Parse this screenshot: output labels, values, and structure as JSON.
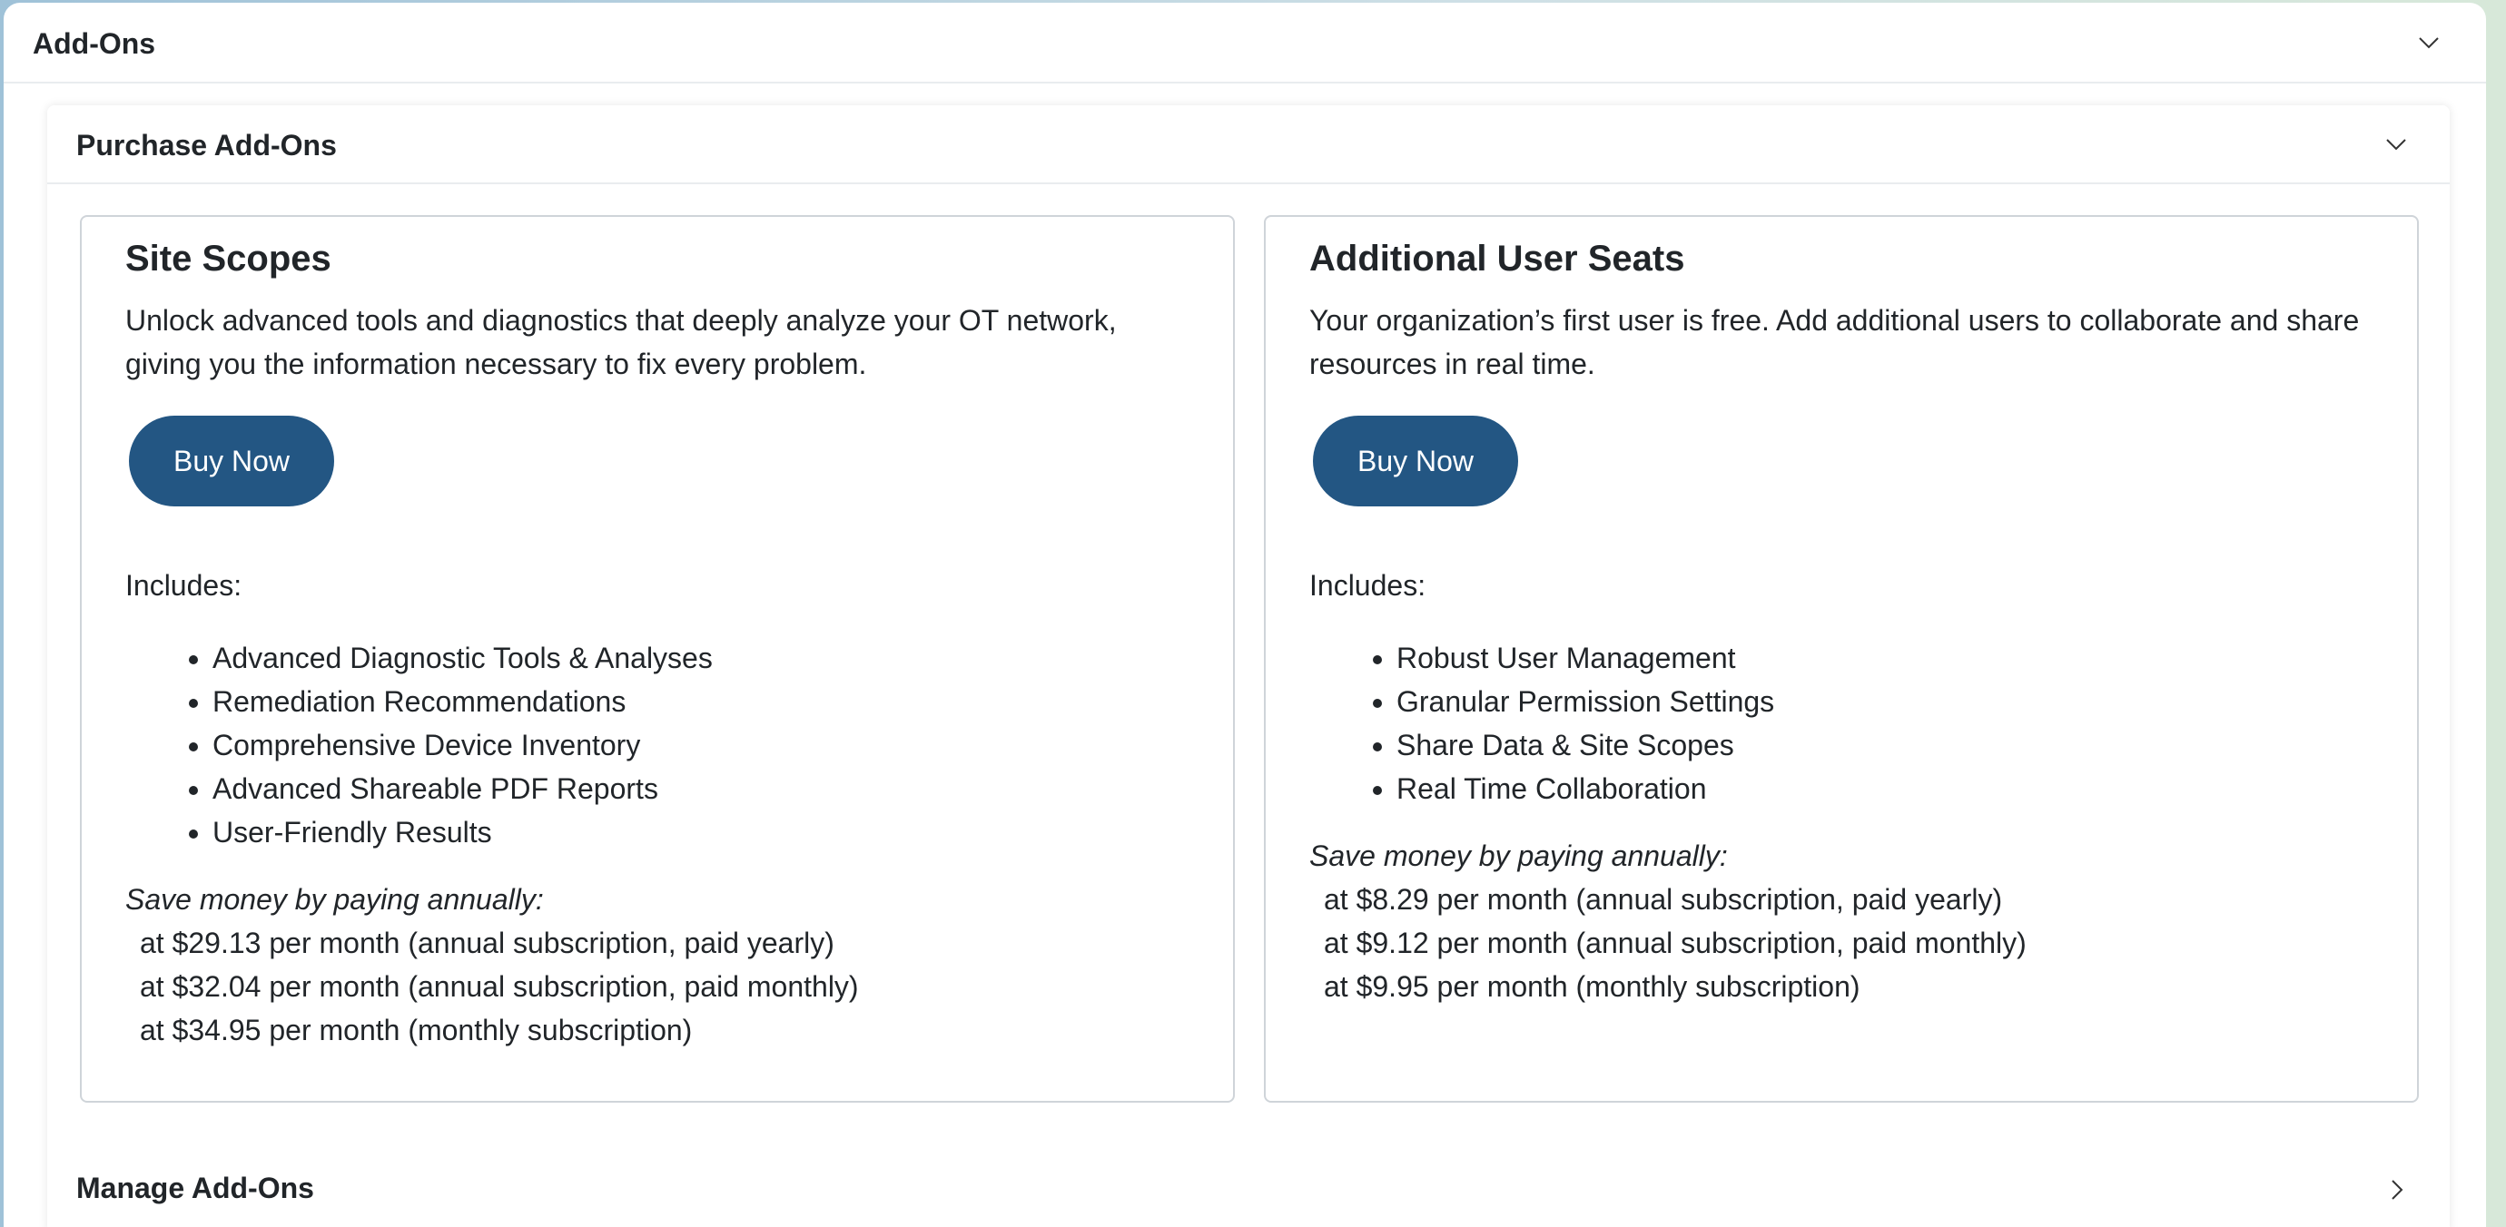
{
  "outer": {
    "title": "Add-Ons",
    "toggle_icon": "chevron-down-icon"
  },
  "purchase": {
    "title": "Purchase Add-Ons",
    "toggle_icon": "chevron-down-icon",
    "cards": [
      {
        "title": "Site Scopes",
        "description": "Unlock advanced tools and diagnostics that deeply analyze your OT network, giving you the information necessary to fix every problem.",
        "button_label": "Buy Now",
        "includes_label": "Includes:",
        "features": [
          "Advanced Diagnostic Tools & Analyses",
          "Remediation Recommendations",
          "Comprehensive Device Inventory",
          "Advanced Shareable PDF Reports",
          "User-Friendly Results"
        ],
        "save_note": "Save money by paying annually:",
        "prices": [
          "at $29.13 per month (annual subscription, paid yearly)",
          "at $32.04 per month (annual subscription, paid monthly)",
          "at $34.95 per month (monthly subscription)"
        ]
      },
      {
        "title": "Additional User Seats",
        "description": "Your organization’s first user is free. Add additional users to collaborate and share resources in real time.",
        "button_label": "Buy Now",
        "includes_label": "Includes:",
        "features": [
          "Robust User Management",
          "Granular Permission Settings",
          "Share Data & Site Scopes",
          "Real Time Collaboration"
        ],
        "save_note": "Save money by paying annually:",
        "prices": [
          "at $8.29 per month (annual subscription, paid yearly)",
          "at $9.12 per month (annual subscription, paid monthly)",
          "at $9.95 per month (monthly subscription)"
        ]
      }
    ]
  },
  "manage": {
    "title": "Manage Add-Ons",
    "toggle_icon": "chevron-right-icon"
  },
  "colors": {
    "button_bg": "#235683",
    "button_text": "#ffffff",
    "card_border": "#cfd4d9"
  }
}
